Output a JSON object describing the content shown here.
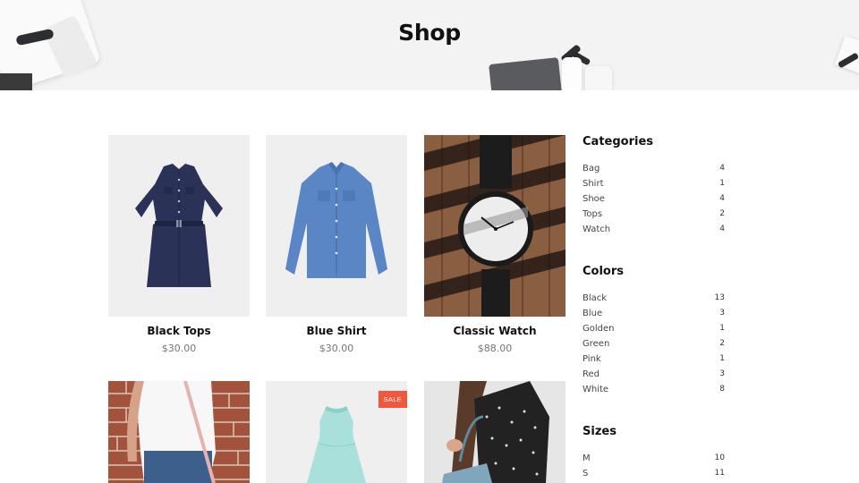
{
  "hero": {
    "title": "Shop"
  },
  "products": [
    {
      "name": "Black Tops",
      "price": "$30.00"
    },
    {
      "name": "Blue Shirt",
      "price": "$30.00"
    },
    {
      "name": "Classic Watch",
      "price": "$88.00"
    },
    {
      "name": "",
      "price": ""
    },
    {
      "name": "",
      "price": "",
      "badge": "SALE"
    },
    {
      "name": "",
      "price": ""
    }
  ],
  "sidebar": {
    "categories": {
      "title": "Categories",
      "items": [
        {
          "label": "Bag",
          "count": "4"
        },
        {
          "label": "Shirt",
          "count": "1"
        },
        {
          "label": "Shoe",
          "count": "4"
        },
        {
          "label": "Tops",
          "count": "2"
        },
        {
          "label": "Watch",
          "count": "4"
        }
      ]
    },
    "colors": {
      "title": "Colors",
      "items": [
        {
          "label": "Black",
          "count": "13"
        },
        {
          "label": "Blue",
          "count": "3"
        },
        {
          "label": "Golden",
          "count": "1"
        },
        {
          "label": "Green",
          "count": "2"
        },
        {
          "label": "Pink",
          "count": "1"
        },
        {
          "label": "Red",
          "count": "3"
        },
        {
          "label": "White",
          "count": "8"
        }
      ]
    },
    "sizes": {
      "title": "Sizes",
      "items": [
        {
          "label": "M",
          "count": "10"
        },
        {
          "label": "S",
          "count": "11"
        }
      ]
    }
  },
  "colors": {
    "sale_badge": "#f0573d",
    "banner_bg": "#f3f3f3",
    "image_bg": "#efefef"
  },
  "icons": [
    "dress-image",
    "shirt-image",
    "watch-image",
    "bag-model-image",
    "sale-dress-image",
    "polka-dot-model-image"
  ]
}
